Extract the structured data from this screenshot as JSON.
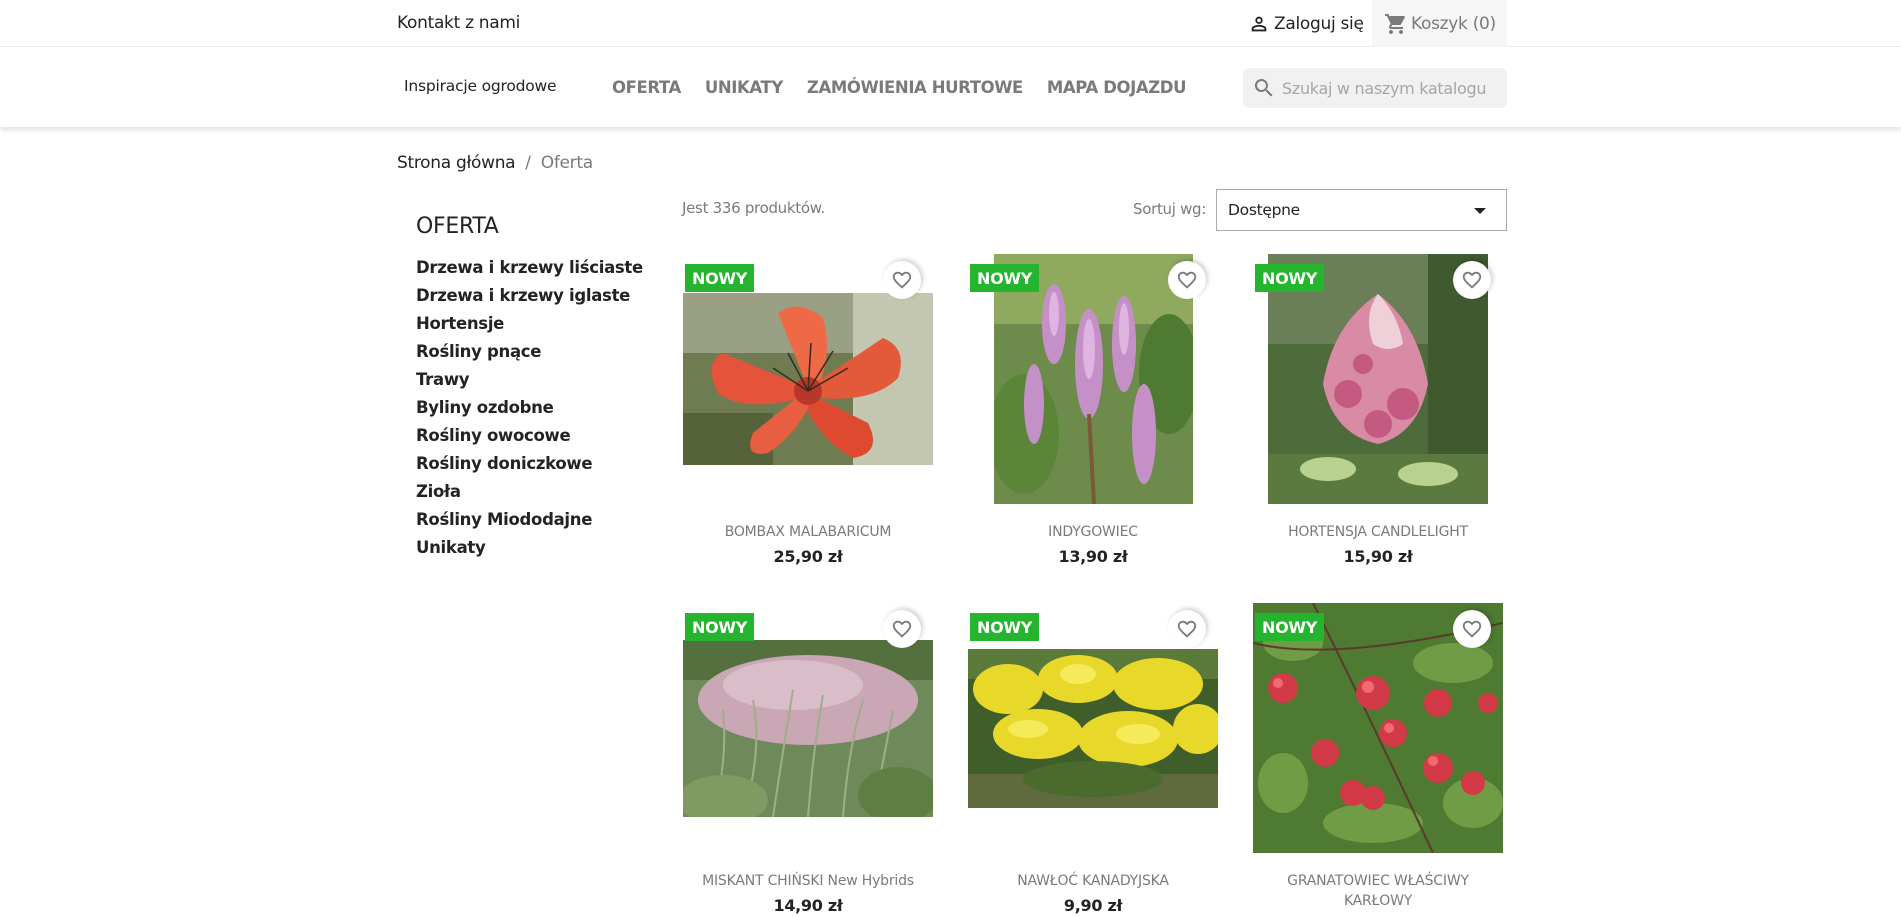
{
  "topbar": {
    "contact": "Kontakt z nami",
    "login": "Zaloguj się",
    "cart": "Koszyk (0)"
  },
  "header": {
    "brand": "Inspiracje ogrodowe",
    "nav": [
      "OFERTA",
      "UNIKATY",
      "ZAMÓWIENIA HURTOWE",
      "MAPA DOJAZDU"
    ],
    "search_placeholder": "Szukaj w naszym katalogu"
  },
  "breadcrumb": {
    "home": "Strona główna",
    "separator": "/",
    "current": "Oferta"
  },
  "sidebar": {
    "title": "OFERTA",
    "items": [
      "Drzewa i krzewy liściaste",
      "Drzewa i krzewy iglaste",
      "Hortensje",
      "Rośliny pnące",
      "Trawy",
      "Byliny ozdobne",
      "Rośliny owocowe",
      "Rośliny doniczkowe",
      "Zioła",
      "Rośliny Miododajne",
      "Unikaty"
    ]
  },
  "listing": {
    "count": "Jest 336 produktów.",
    "sort_label": "Sortuj wg:",
    "sort_value": "Dostępne"
  },
  "products": [
    {
      "name": "BOMBAX MALABARICUM",
      "price": "25,90 zł",
      "badge": "NOWY"
    },
    {
      "name": "INDYGOWIEC",
      "price": "13,90 zł",
      "badge": "NOWY"
    },
    {
      "name": "HORTENSJA CANDLELIGHT",
      "price": "15,90 zł",
      "badge": "NOWY"
    },
    {
      "name": "MISKANT CHIŃSKI New Hybrids",
      "price": "14,90 zł",
      "badge": "NOWY"
    },
    {
      "name": "NAWŁOĆ KANADYJSKA",
      "price": "9,90 zł",
      "badge": "NOWY"
    },
    {
      "name": "GRANATOWIEC WŁAŚCIWY KARŁOWY",
      "price": "",
      "badge": "NOWY"
    }
  ],
  "colors": {
    "badge": "#24b42e",
    "text": "#232323",
    "muted": "#7a7a7a"
  }
}
